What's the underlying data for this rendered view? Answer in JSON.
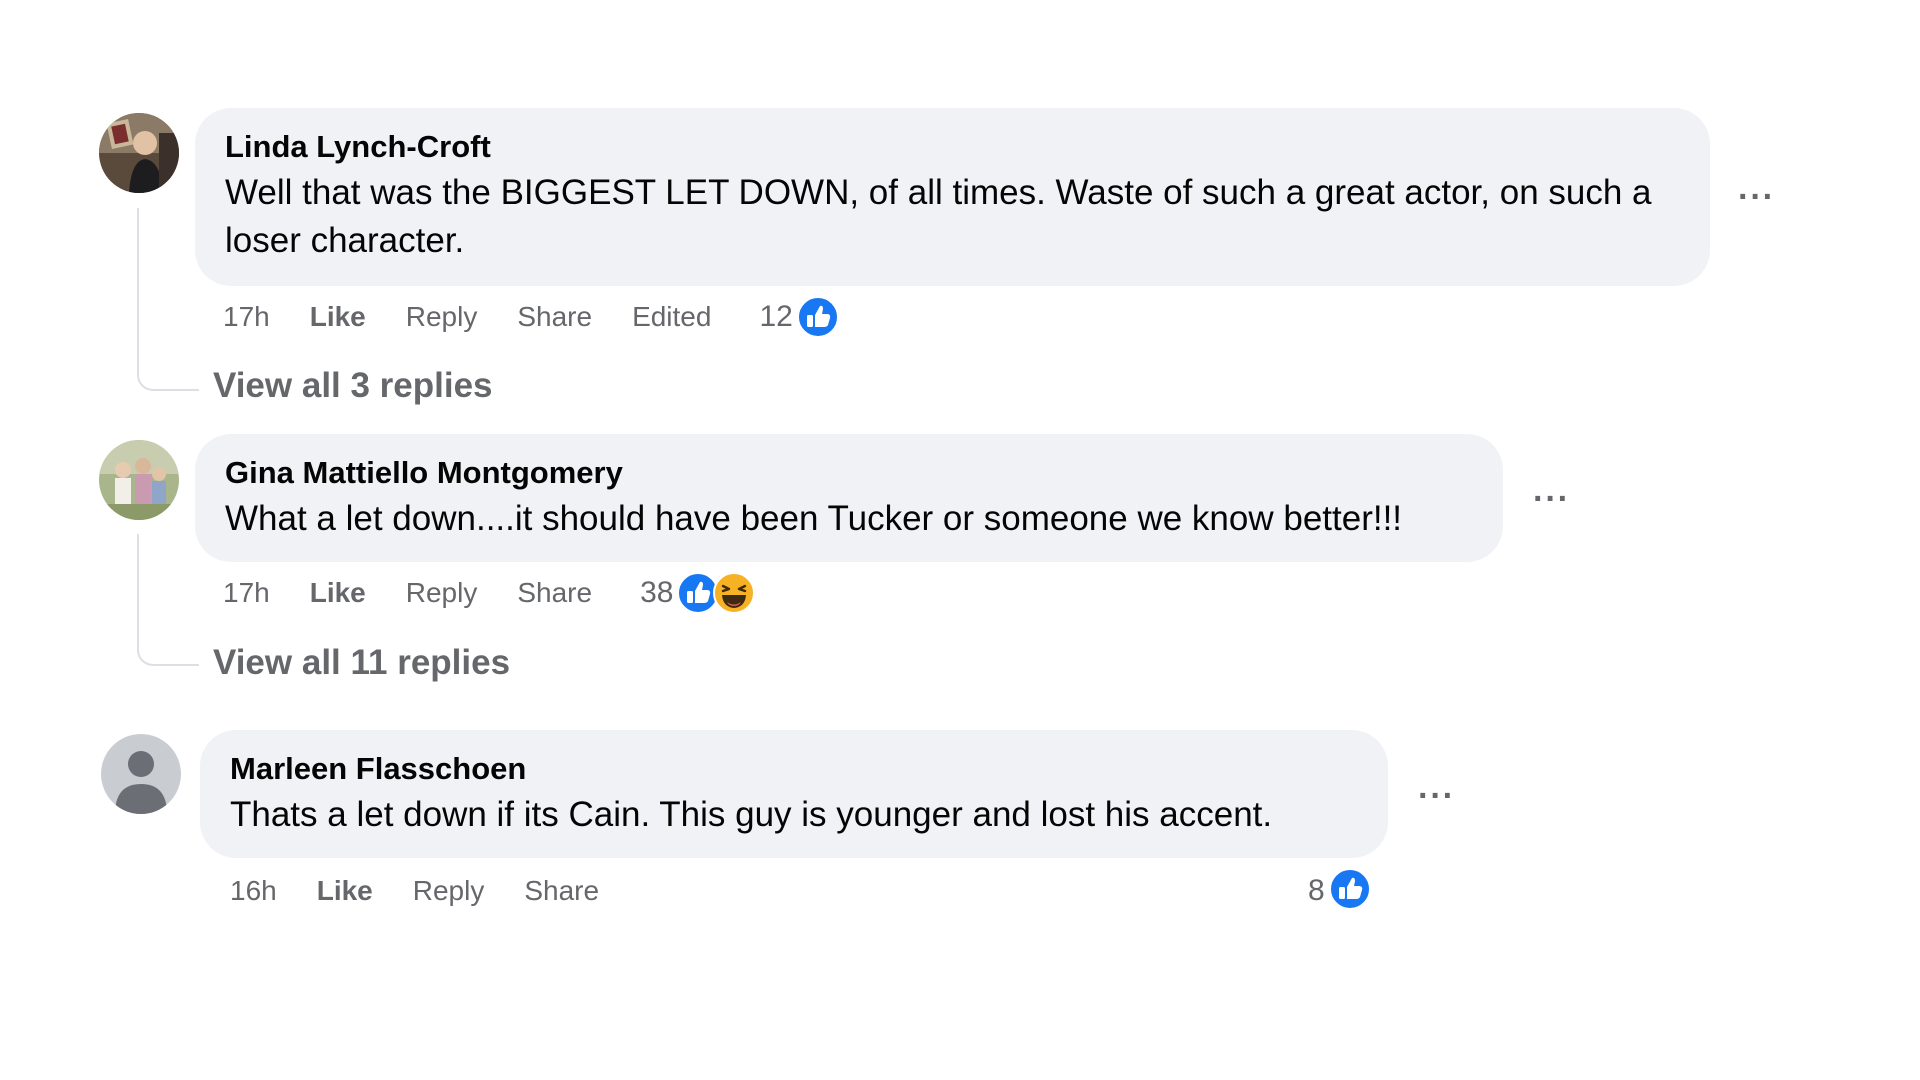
{
  "comments": [
    {
      "author": "Linda Lynch-Croft",
      "text": "Well that was the BIGGEST LET DOWN, of all times. Waste of such a great actor, on such a loser character.",
      "time": "17h",
      "like_label": "Like",
      "reply_label": "Reply",
      "share_label": "Share",
      "edited_label": "Edited",
      "reaction_count": "12",
      "reactions": [
        "like-icon"
      ],
      "view_replies": "View all 3 replies"
    },
    {
      "author": "Gina Mattiello Montgomery",
      "text": "What a let down....it should have been Tucker or someone we know better!!!",
      "time": "17h",
      "like_label": "Like",
      "reply_label": "Reply",
      "share_label": "Share",
      "reaction_count": "38",
      "reactions": [
        "like-icon",
        "haha-icon"
      ],
      "view_replies": "View all 11 replies"
    },
    {
      "author": "Marleen Flasschoen",
      "text": "Thats a let down if its Cain. This guy is younger and lost his accent.",
      "time": "16h",
      "like_label": "Like",
      "reply_label": "Reply",
      "share_label": "Share",
      "reaction_count": "8",
      "reactions": [
        "like-icon"
      ]
    }
  ],
  "colors": {
    "bubble": "#f0f2f5",
    "meta_text": "#65676b",
    "like_blue": "#1877f2",
    "haha_yellow": "#f7b125"
  }
}
